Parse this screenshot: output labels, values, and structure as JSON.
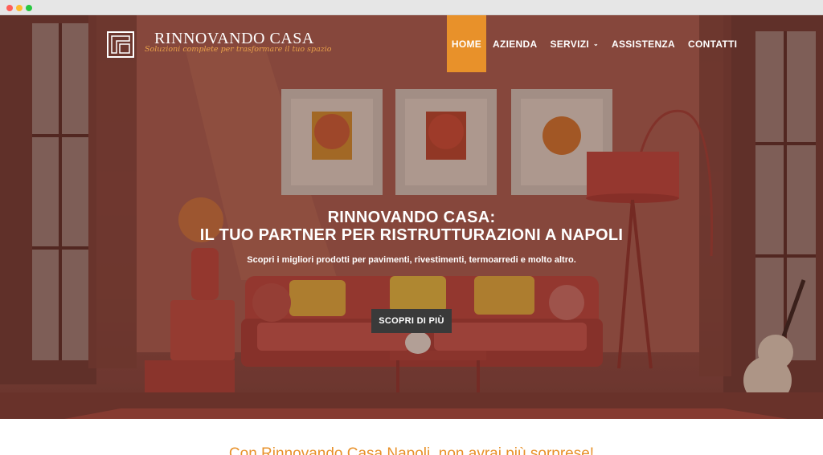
{
  "brand": {
    "name": "RINNOVANDO CASA",
    "tagline": "Soluzioni complete per trasformare il tuo spazio"
  },
  "nav": {
    "items": [
      {
        "label": "HOME",
        "active": true
      },
      {
        "label": "AZIENDA",
        "active": false
      },
      {
        "label": "SERVIZI",
        "active": false,
        "has_dropdown": true
      },
      {
        "label": "ASSISTENZA",
        "active": false
      },
      {
        "label": "CONTATTI",
        "active": false
      }
    ]
  },
  "hero": {
    "title_line1": "RINNOVANDO CASA:",
    "title_line2": "IL TUO PARTNER PER RISTRUTTURAZIONI A NAPOLI",
    "subtitle": "Scopri i migliori prodotti per pavimenti, rivestimenti, termoarredi e molto altro.",
    "cta_label": "SCOPRI DI PIÙ"
  },
  "section": {
    "heading": "Con Rinnovando Casa Napoli, non avrai più sorprese!"
  },
  "colors": {
    "accent": "#e8912a",
    "button": "#3a3a3a",
    "wall": "#9b5248"
  }
}
